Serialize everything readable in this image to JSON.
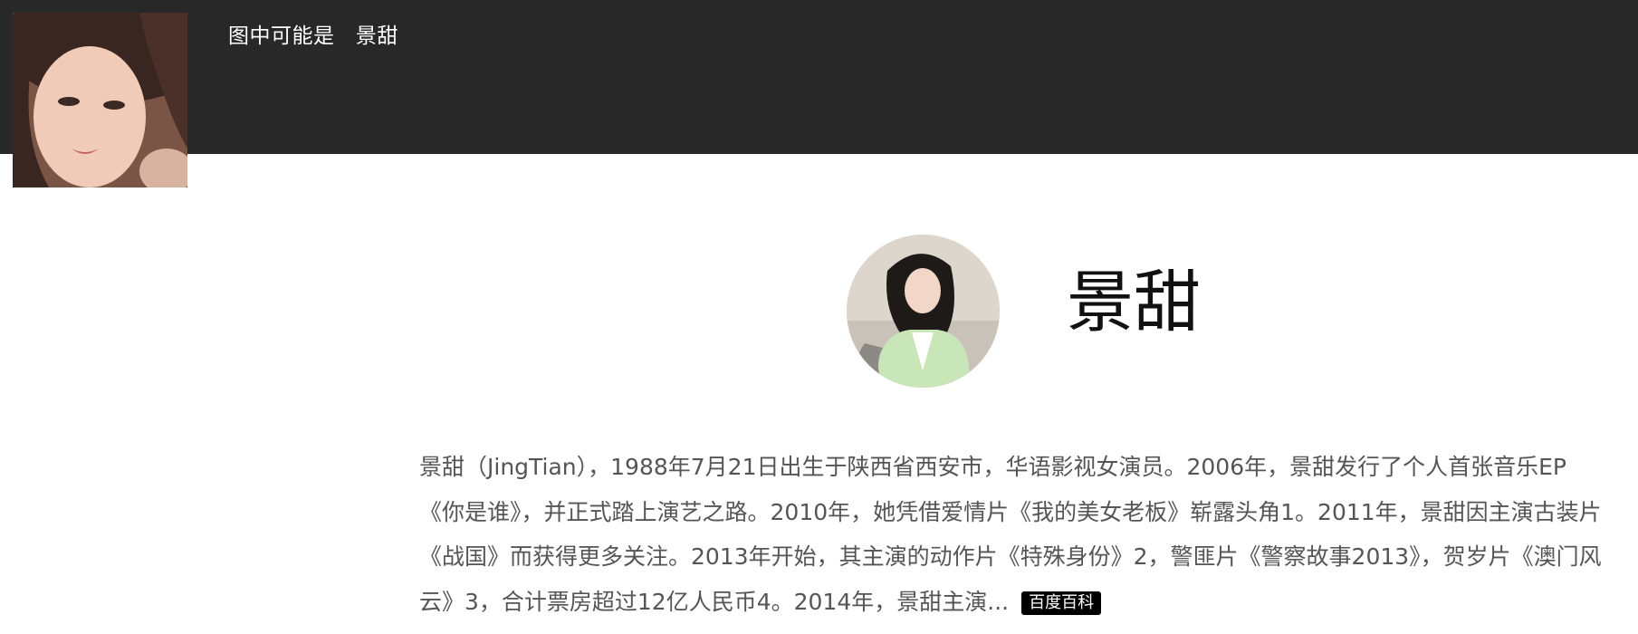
{
  "header": {
    "caption": "图中可能是   景甜"
  },
  "profile": {
    "name": "景甜"
  },
  "description": {
    "text": "景甜（JingTian），1988年7月21日出生于陕西省西安市，华语影视女演员。2006年，景甜发行了个人首张音乐EP《你是谁》，并正式踏上演艺之路。2010年，她凭借爱情片《我的美女老板》崭露头角1。2011年，景甜因主演古装片《战国》而获得更多关注。2013年开始，其主演的动作片《特殊身份》2，警匪片《警察故事2013》，贺岁片《澳门风云》3，合计票房超过12亿人民币4。2014年，景甜主演...",
    "source_badge": "百度百科"
  },
  "colors": {
    "topbar": "#282828",
    "text_gray": "#555555",
    "badge_bg": "#000000"
  },
  "icons": [
    "face-thumbnail",
    "avatar-photo"
  ]
}
